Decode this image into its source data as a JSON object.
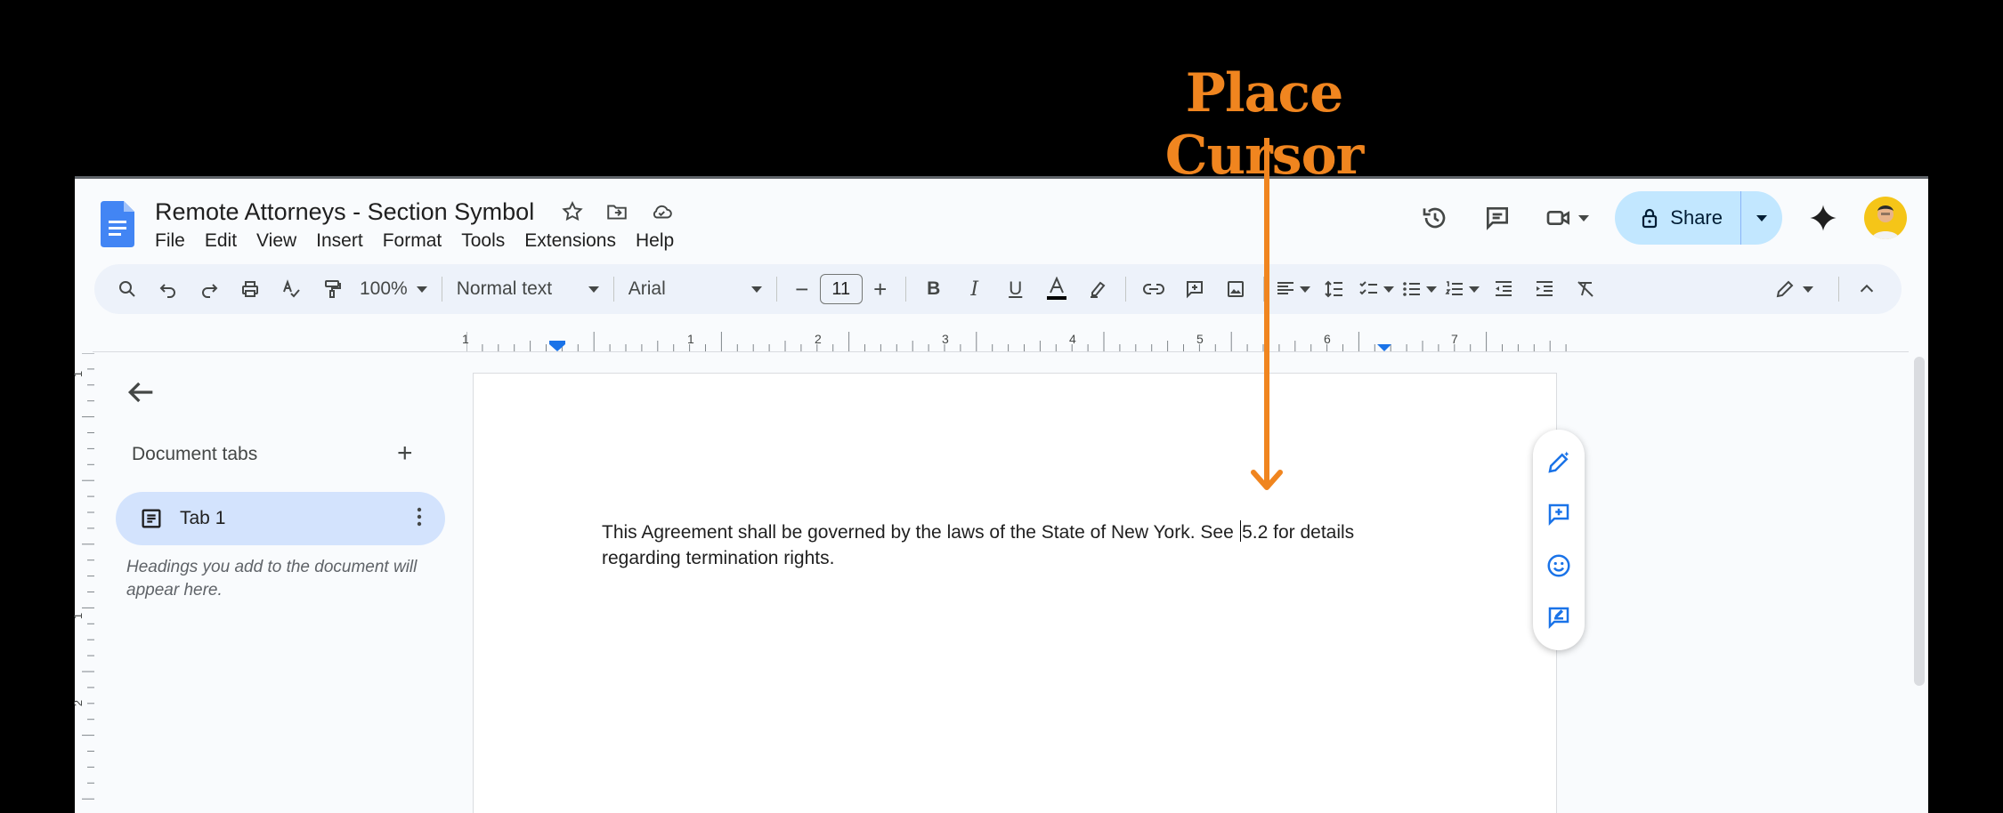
{
  "annotation": {
    "text": "Place Cursor",
    "color": "#f0851f"
  },
  "document": {
    "title": "Remote Attorneys - Section Symbol"
  },
  "menu": [
    "File",
    "Edit",
    "View",
    "Insert",
    "Format",
    "Tools",
    "Extensions",
    "Help"
  ],
  "header": {
    "share_label": "Share"
  },
  "toolbar": {
    "zoom": "100%",
    "style": "Normal text",
    "font": "Arial",
    "font_size": "11",
    "minus": "−",
    "plus": "+"
  },
  "ruler": {
    "labels": [
      "1",
      "1",
      "2",
      "3",
      "4",
      "5",
      "6",
      "7"
    ]
  },
  "vruler": {
    "labels": [
      "1",
      "1",
      "2"
    ]
  },
  "sidebar": {
    "title": "Document tabs",
    "add": "+",
    "tab_label": "Tab 1",
    "hint": "Headings you add to the document will appear here."
  },
  "body": {
    "line_before_cursor": "This Agreement shall be governed by the laws of the State of New York. See ",
    "line_after_cursor": "5.2 for details regarding termination rights."
  },
  "colors": {
    "accent": "#1a73e8",
    "share_bg": "#c2e7ff",
    "annotation": "#f0851f"
  }
}
